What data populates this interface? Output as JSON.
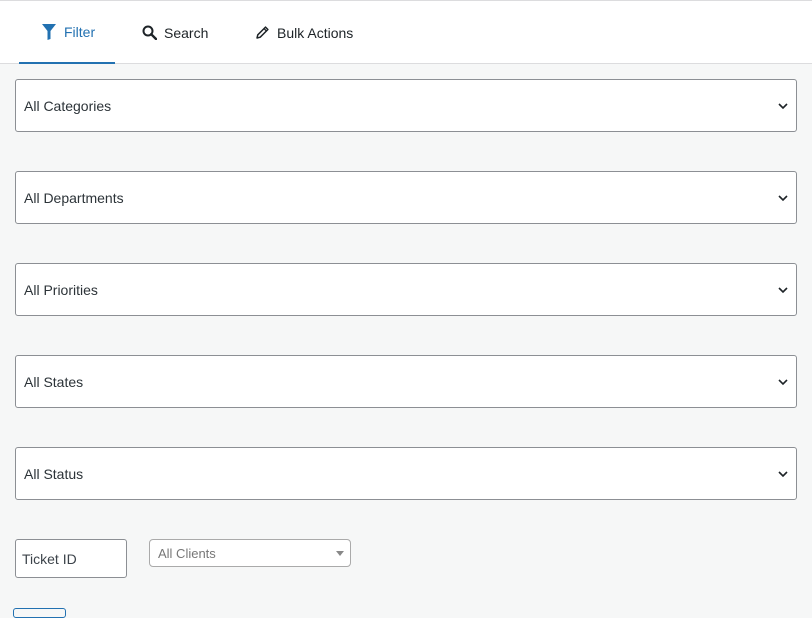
{
  "tabs": [
    {
      "label": "Filter",
      "icon": "filter-icon",
      "active": true
    },
    {
      "label": "Search",
      "icon": "search-icon",
      "active": false
    },
    {
      "label": "Bulk Actions",
      "icon": "pencil-icon",
      "active": false
    }
  ],
  "filters": {
    "category": "All Categories",
    "department": "All Departments",
    "priority": "All Priorities",
    "state": "All States",
    "status": "All Status"
  },
  "ticket_id": {
    "placeholder": "Ticket ID",
    "value": ""
  },
  "clients": {
    "selected": "All Clients"
  },
  "colors": {
    "accent": "#2271b1",
    "border": "#8c8f94",
    "background": "#f6f7f7"
  }
}
